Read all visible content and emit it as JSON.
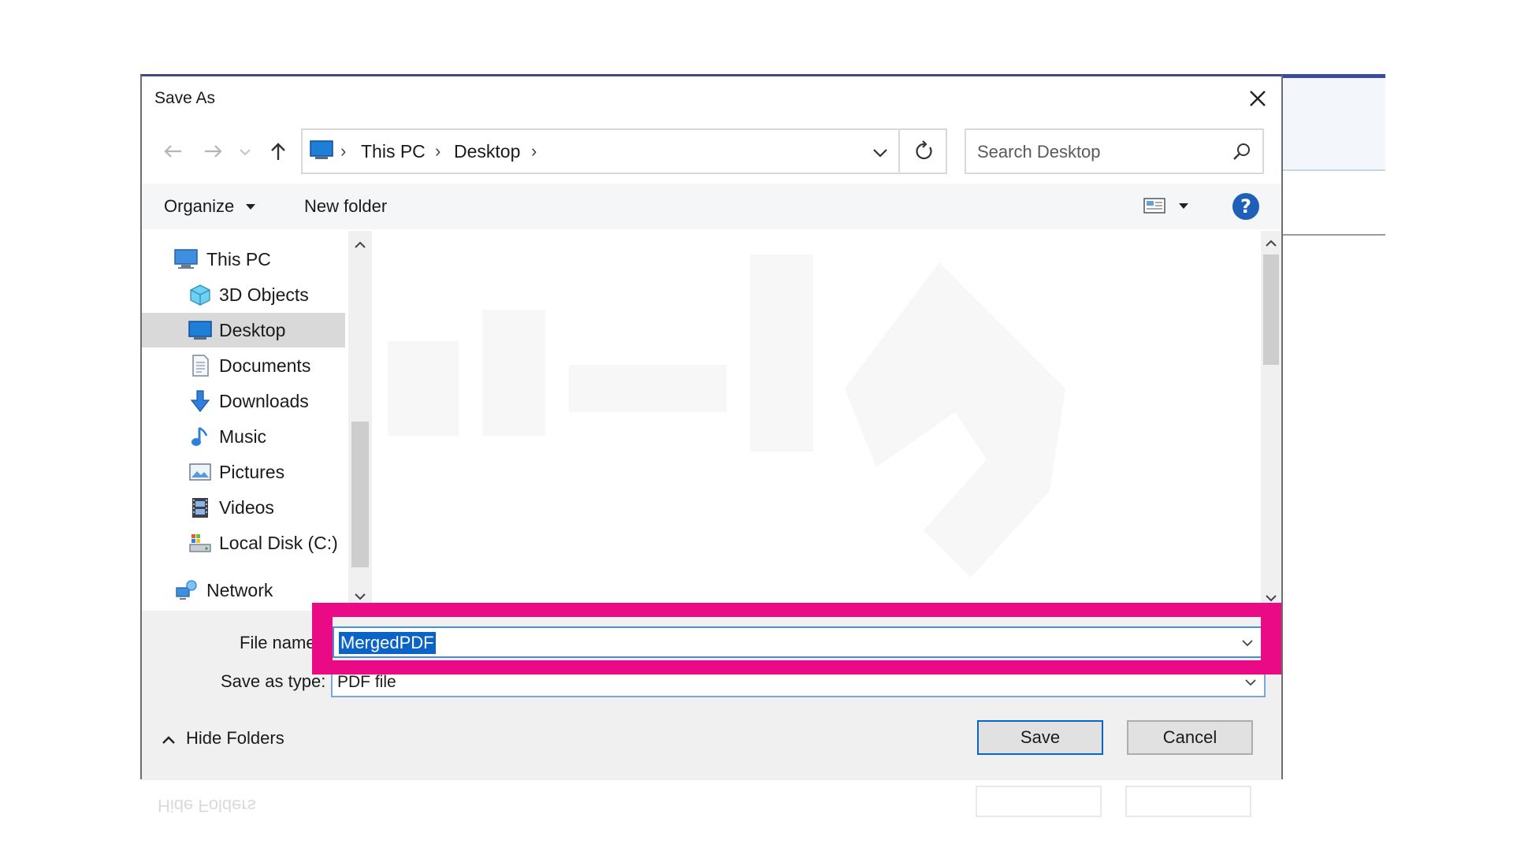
{
  "dialog": {
    "title": "Save As"
  },
  "nav": {
    "back_label": "Back",
    "forward_label": "Forward",
    "path": [
      "This PC",
      "Desktop"
    ],
    "search_placeholder": "Search Desktop"
  },
  "toolbar": {
    "organize": "Organize",
    "new_folder": "New folder",
    "help": "?"
  },
  "sidebar": {
    "items": [
      {
        "label": "This PC",
        "icon": "computer-icon",
        "level": 0
      },
      {
        "label": "3D Objects",
        "icon": "cube-icon",
        "level": 1
      },
      {
        "label": "Desktop",
        "icon": "desktop-icon",
        "level": 1,
        "selected": true
      },
      {
        "label": "Documents",
        "icon": "document-icon",
        "level": 1
      },
      {
        "label": "Downloads",
        "icon": "download-arrow-icon",
        "level": 1
      },
      {
        "label": "Music",
        "icon": "music-note-icon",
        "level": 1
      },
      {
        "label": "Pictures",
        "icon": "picture-icon",
        "level": 1
      },
      {
        "label": "Videos",
        "icon": "film-icon",
        "level": 1
      },
      {
        "label": "Local Disk (C:)",
        "icon": "disk-icon",
        "level": 1
      },
      {
        "label": "Network",
        "icon": "network-icon",
        "level": 0
      }
    ]
  },
  "fields": {
    "file_name_label": "File name:",
    "file_name_value": "MergedPDF",
    "save_type_label": "Save as type:",
    "save_type_value": "PDF file"
  },
  "footer": {
    "hide_folders": "Hide Folders",
    "save": "Save",
    "cancel": "Cancel"
  },
  "colors": {
    "highlight": "#ea0a86",
    "selection": "#0a63c7",
    "help": "#1e5fb8"
  }
}
